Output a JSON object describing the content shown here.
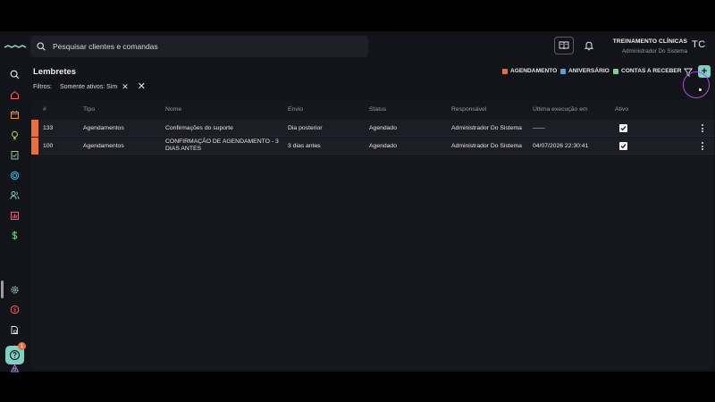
{
  "search": {
    "placeholder": "Pesquisar clientes e comandas"
  },
  "user": {
    "org": "TREINAMENTO CLÍNICAS",
    "role": "Administrador Do Sistema",
    "initials": "TC"
  },
  "page": {
    "title": "Lembretes"
  },
  "filters": {
    "label": "Filtros:",
    "chips": [
      {
        "label": "Somente ativos: Sim"
      }
    ]
  },
  "legend": [
    {
      "label": "AGENDAMENTO",
      "color": "#e8703d"
    },
    {
      "label": "ANIVERSÁRIO",
      "color": "#5aa0d8"
    },
    {
      "label": "CONTAS A RECEBER",
      "color": "#7fd08a"
    }
  ],
  "help": {
    "badge": "1"
  },
  "table": {
    "columns": [
      "#",
      "Tipo",
      "Nome",
      "Envio",
      "Status",
      "Responsável",
      "Última execução em",
      "Ativo"
    ],
    "rows": [
      {
        "id": "133",
        "tipo": "Agendamentos",
        "nome": "Confirmações do suporte",
        "envio": "Dia posterior",
        "status": "Agendado",
        "responsavel": "Administrador Do Sistema",
        "ultima": "——",
        "ativo": true,
        "color": "#e8703d"
      },
      {
        "id": "100",
        "tipo": "Agendamentos",
        "nome": "CONFIRMAÇÃO DE AGENDAMENTO - 3 DIAS ANTES",
        "envio": "3 dias antes",
        "status": "Agendado",
        "responsavel": "Administrador Do Sistema",
        "ultima": "04/07/2026 22:30:41",
        "ativo": true,
        "color": "#e8703d"
      }
    ]
  },
  "sidebar": {
    "icons": [
      {
        "name": "search-icon",
        "color": "#e6e6ea"
      },
      {
        "name": "home-icon",
        "color": "#e8646e"
      },
      {
        "name": "calendar-icon",
        "color": "#e8963d"
      },
      {
        "name": "lightbulb-icon",
        "color": "#b6d94a"
      },
      {
        "name": "clipboard-icon",
        "color": "#7fd08a"
      },
      {
        "name": "target-icon",
        "color": "#4fb8e0"
      },
      {
        "name": "users-icon",
        "color": "#7fcfc2"
      },
      {
        "name": "chart-icon",
        "color": "#e8646e"
      },
      {
        "name": "dollar-icon",
        "color": "#7fd08a"
      },
      {
        "name": "settings-icon",
        "color": "#7fcfc2"
      },
      {
        "name": "coin-icon",
        "color": "#e8646e"
      },
      {
        "name": "document-lock-icon",
        "color": "#e6e6ea"
      },
      {
        "name": "box-icon",
        "color": "#e8646e"
      },
      {
        "name": "network-icon",
        "color": "#a48cf0"
      }
    ]
  }
}
